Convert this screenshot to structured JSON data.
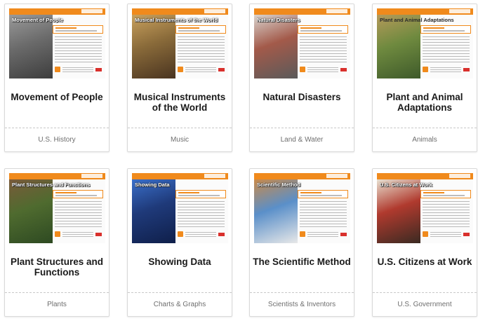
{
  "cards": [
    {
      "title": "Movement of People",
      "category": "U.S. History",
      "thumb_heading": "Movement of People",
      "thumb_dark_heading": false,
      "photo_colors": [
        "#6b6b6b",
        "#9a9a9a",
        "#3d3d3d"
      ]
    },
    {
      "title": "Musical Instruments of the World",
      "category": "Music",
      "thumb_heading": "Musical Instruments of the World",
      "thumb_dark_heading": false,
      "photo_colors": [
        "#8a6b3a",
        "#c9a15e",
        "#4a3420"
      ]
    },
    {
      "title": "Natural Disasters",
      "category": "Land & Water",
      "thumb_heading": "Natural Disasters",
      "thumb_dark_heading": false,
      "photo_colors": [
        "#a35a4a",
        "#d9d4cf",
        "#5a5a5a"
      ]
    },
    {
      "title": "Plant and Animal Adaptations",
      "category": "Animals",
      "thumb_heading": "Plant and Animal Adaptations",
      "thumb_dark_heading": true,
      "photo_colors": [
        "#6f8a3f",
        "#b59a5a",
        "#3e5a2a"
      ]
    },
    {
      "title": "Plant Structures and Functions",
      "category": "Plants",
      "thumb_heading": "Plant Structures and Functions",
      "thumb_dark_heading": false,
      "photo_colors": [
        "#4f6b2f",
        "#7a5a3a",
        "#2e4a22"
      ]
    },
    {
      "title": "Showing Data",
      "category": "Charts & Graphs",
      "thumb_heading": "Showing Data",
      "thumb_dark_heading": false,
      "photo_colors": [
        "#1f3a7a",
        "#3a6fc9",
        "#0f1f4a"
      ]
    },
    {
      "title": "The Scientific Method",
      "category": "Scientists & Inventors",
      "thumb_heading": "Scientific Method",
      "thumb_dark_heading": false,
      "photo_colors": [
        "#5a8fc9",
        "#c98a4a",
        "#e8e8e8"
      ]
    },
    {
      "title": "U.S. Citizens at Work",
      "category": "U.S. Government",
      "thumb_heading": "U.S. Citizens at Work",
      "thumb_dark_heading": false,
      "photo_colors": [
        "#b03a2e",
        "#e8e0d0",
        "#3a2a22"
      ]
    }
  ],
  "colors": {
    "accent": "#f08a1c",
    "card_border": "#d9d9d9",
    "title_text": "#1a1a1a",
    "category_text": "#6e6e6e"
  }
}
